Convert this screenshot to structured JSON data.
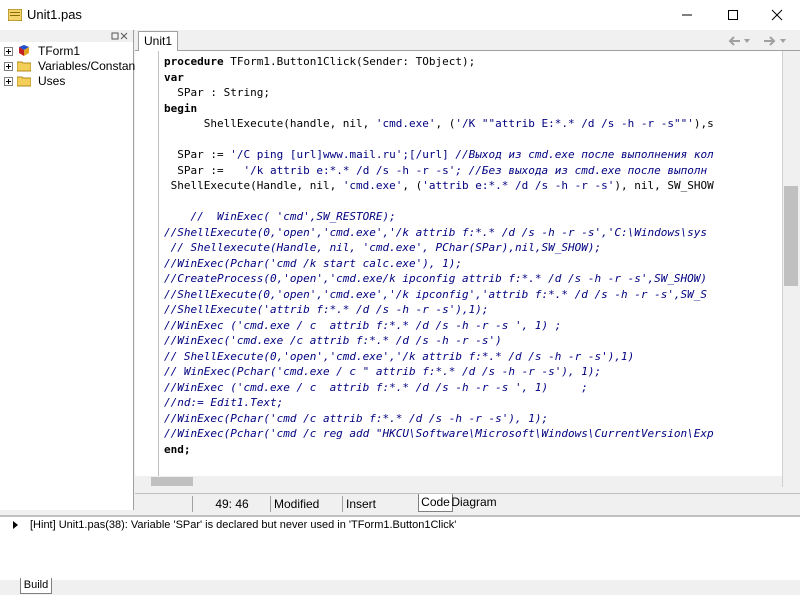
{
  "window": {
    "title": "Unit1.pas"
  },
  "tree": {
    "items": [
      {
        "label": "TForm1",
        "icon": "form-icon"
      },
      {
        "label": "Variables/Constants",
        "icon": "folder-icon"
      },
      {
        "label": "Uses",
        "icon": "folder-icon"
      }
    ]
  },
  "editor": {
    "tab_label": "Unit1",
    "lines": [
      [
        {
          "t": "procedure",
          "c": "kw"
        },
        {
          "t": " TForm1.Button1Click(Sender: TObject);",
          "c": "tx"
        }
      ],
      [
        {
          "t": "var",
          "c": "kw"
        }
      ],
      [
        {
          "t": "  SPar : String;",
          "c": "tx"
        }
      ],
      [
        {
          "t": "begin",
          "c": "kw"
        }
      ],
      [
        {
          "t": "      ShellExecute(handle, nil, ",
          "c": "tx"
        },
        {
          "t": "'cmd.exe'",
          "c": "str"
        },
        {
          "t": ", (",
          "c": "tx"
        },
        {
          "t": "'/K \"\"attrib E:*.* /d /s -h -r -s\"\"'",
          "c": "str"
        },
        {
          "t": "),s",
          "c": "tx"
        }
      ],
      [],
      [
        {
          "t": "  SPar := ",
          "c": "tx"
        },
        {
          "t": "'/C ping [url]www.mail.ru';[/url]",
          "c": "str"
        },
        {
          "t": " //Выход из cmd.exe после выполнения кол",
          "c": "cm"
        }
      ],
      [
        {
          "t": "  SPar :=   ",
          "c": "tx"
        },
        {
          "t": "'/k attrib e:*.* /d /s -h -r -s'",
          "c": "str"
        },
        {
          "t": "; //Без выхода из cmd.exe после выполн",
          "c": "cm"
        }
      ],
      [
        {
          "t": " ShellExecute(Handle, nil, ",
          "c": "tx"
        },
        {
          "t": "'cmd.exe'",
          "c": "str"
        },
        {
          "t": ", (",
          "c": "tx"
        },
        {
          "t": "'attrib e:*.* /d /s -h -r -s'",
          "c": "str"
        },
        {
          "t": "), nil, SW_SHOW",
          "c": "tx"
        }
      ],
      [],
      [
        {
          "t": "    //  WinExec( 'cmd',SW_RESTORE);",
          "c": "cm"
        }
      ],
      [
        {
          "t": "//ShellExecute(0,'open','cmd.exe','/k attrib f:*.* /d /s -h -r -s','C:\\Windows\\sys",
          "c": "cm"
        }
      ],
      [
        {
          "t": " // Shellexecute(Handle, nil, 'cmd.exe', PChar(SPar),nil,SW_SHOW);",
          "c": "cm"
        }
      ],
      [
        {
          "t": "//WinExec(Pchar('cmd /k start calc.exe'), 1);",
          "c": "cm"
        }
      ],
      [
        {
          "t": "//CreateProcess(0,'open','cmd.exe/k ipconfig attrib f:*.* /d /s -h -r -s',SW_SHOW)",
          "c": "cm"
        }
      ],
      [
        {
          "t": "//ShellExecute(0,'open','cmd.exe','/k ipconfig','attrib f:*.* /d /s -h -r -s',SW_S",
          "c": "cm"
        }
      ],
      [
        {
          "t": "//ShellExecute('attrib f:*.* /d /s -h -r -s'),1);",
          "c": "cm"
        }
      ],
      [
        {
          "t": "//WinExec ('cmd.exe / c  attrib f:*.* /d /s -h -r -s ', 1) ;",
          "c": "cm"
        }
      ],
      [
        {
          "t": "//WinExec('cmd.exe /c attrib f:*.* /d /s -h -r -s')",
          "c": "cm"
        }
      ],
      [
        {
          "t": "// ShellExecute(0,'open','cmd.exe','/k attrib f:*.* /d /s -h -r -s'),1)",
          "c": "cm"
        }
      ],
      [
        {
          "t": "// WinExec(Pchar('cmd.exe / c \" attrib f:*.* /d /s -h -r -s'), 1);",
          "c": "cm"
        }
      ],
      [
        {
          "t": "//WinExec ('cmd.exe / c  attrib f:*.* /d /s -h -r -s ', 1)     ;",
          "c": "cm"
        }
      ],
      [
        {
          "t": "//nd:= Edit1.Text;",
          "c": "cm"
        }
      ],
      [
        {
          "t": "//WinExec(Pchar('cmd /c attrib f:*.* /d /s -h -r -s'), 1);",
          "c": "cm"
        }
      ],
      [
        {
          "t": "//WinExec(Pchar('cmd /c reg add \"HKCU\\Software\\Microsoft\\Windows\\CurrentVersion\\Exp",
          "c": "cm"
        }
      ],
      [
        {
          "t": "end;",
          "c": "kw"
        }
      ]
    ]
  },
  "status": {
    "position": "49:  46",
    "modified": "Modified",
    "mode": "Insert"
  },
  "bottom_tabs": {
    "code": "Code",
    "diagram": "Diagram"
  },
  "messages": {
    "hint": "[Hint] Unit1.pas(38): Variable 'SPar' is declared but never used in 'TForm1.Button1Click'",
    "tab": "Build"
  }
}
